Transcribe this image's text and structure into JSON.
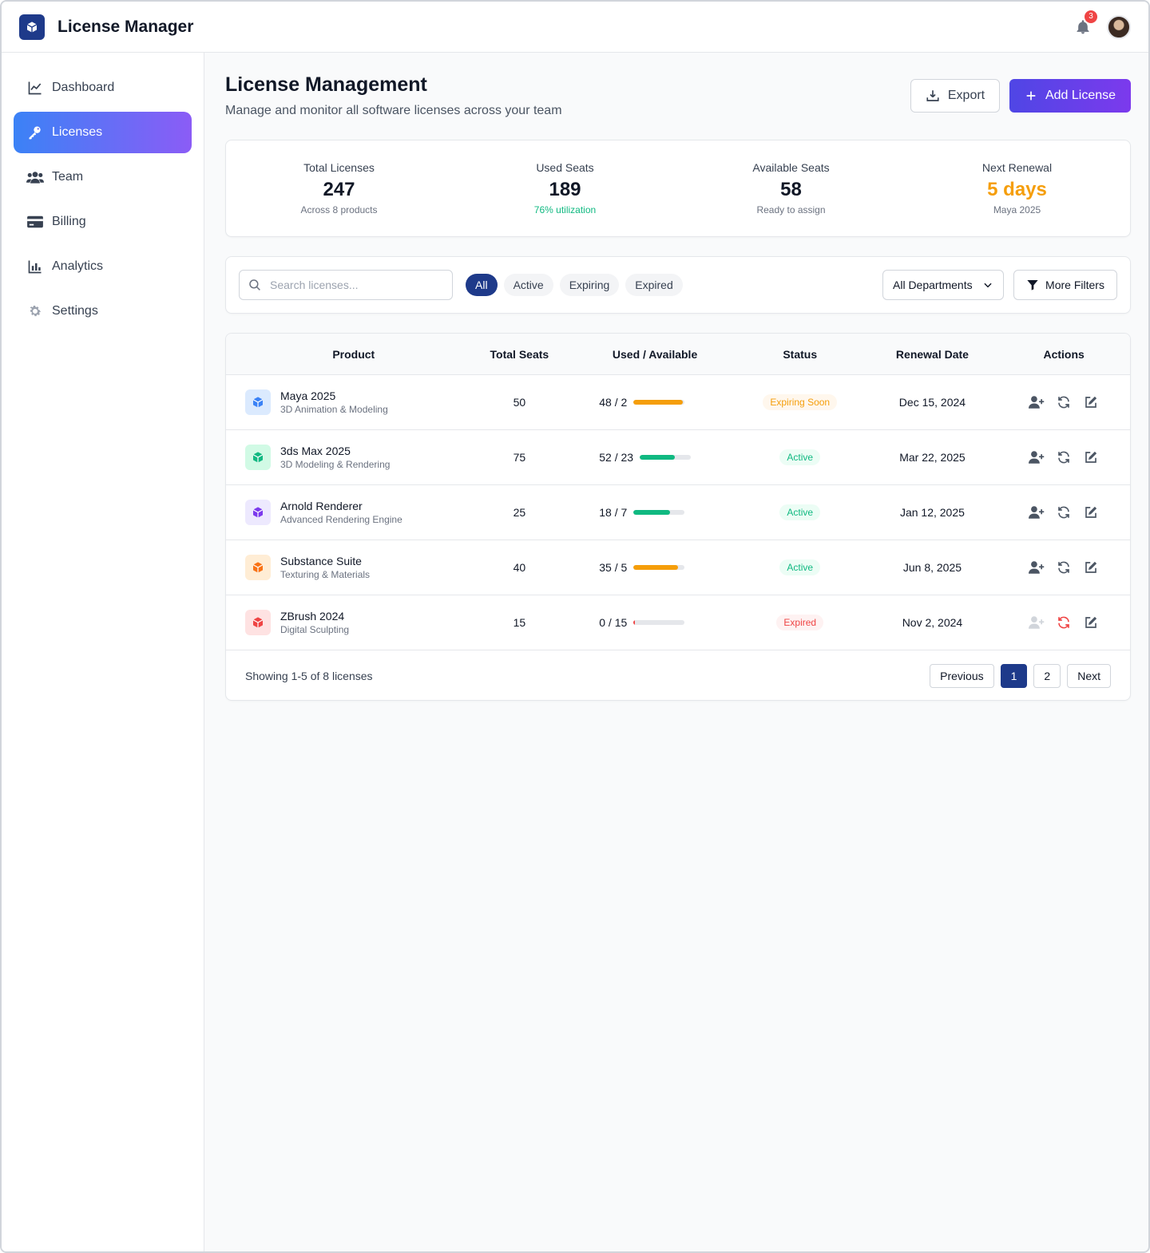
{
  "app": {
    "title": "License Manager",
    "notification_count": "3"
  },
  "sidebar": {
    "items": [
      {
        "label": "Dashboard",
        "icon": "chart-line-icon",
        "active": false
      },
      {
        "label": "Licenses",
        "icon": "key-icon",
        "active": true
      },
      {
        "label": "Team",
        "icon": "users-icon",
        "active": false
      },
      {
        "label": "Billing",
        "icon": "credit-card-icon",
        "active": false
      },
      {
        "label": "Analytics",
        "icon": "bar-chart-icon",
        "active": false
      },
      {
        "label": "Settings",
        "icon": "gear-icon",
        "active": false
      }
    ]
  },
  "page": {
    "title": "License Management",
    "subtitle": "Manage and monitor all software licenses across your team",
    "export_label": "Export",
    "add_label": "Add License"
  },
  "stats": [
    {
      "label": "Total Licenses",
      "value": "247",
      "sub": "Across 8 products"
    },
    {
      "label": "Used Seats",
      "value": "189",
      "sub": "76% utilization"
    },
    {
      "label": "Available Seats",
      "value": "58",
      "sub": "Ready to assign"
    },
    {
      "label": "Next Renewal",
      "value": "5 days",
      "sub": "Maya 2025"
    }
  ],
  "filters": {
    "search_placeholder": "Search licenses...",
    "chips": [
      "All",
      "Active",
      "Expiring",
      "Expired"
    ],
    "active_chip": "All",
    "department": "All Departments",
    "more_filters": "More Filters"
  },
  "table": {
    "headers": {
      "product": "Product",
      "total": "Total Seats",
      "used": "Used / Available",
      "status": "Status",
      "renewal": "Renewal Date",
      "actions": "Actions"
    },
    "rows": [
      {
        "name": "Maya 2025",
        "desc": "3D Animation & Modeling",
        "total": "50",
        "used": "48 / 2",
        "usage": 0.96,
        "bar_color": "#f59e0b",
        "status": "Expiring Soon",
        "status_bg": "#fff7ed",
        "status_fg": "#f59e0b",
        "renewal": "Dec 15, 2024",
        "icon_bg": "#dbeafe",
        "icon_fg": "#3b82f6",
        "assign_enabled": true,
        "renew_alert": false
      },
      {
        "name": "3ds Max 2025",
        "desc": "3D Modeling & Rendering",
        "total": "75",
        "used": "52 / 23",
        "usage": 0.69,
        "bar_color": "#10b981",
        "status": "Active",
        "status_bg": "#ecfdf5",
        "status_fg": "#10b981",
        "renewal": "Mar 22, 2025",
        "icon_bg": "#d1fae5",
        "icon_fg": "#10b981",
        "assign_enabled": true,
        "renew_alert": false
      },
      {
        "name": "Arnold Renderer",
        "desc": "Advanced Rendering Engine",
        "total": "25",
        "used": "18 / 7",
        "usage": 0.72,
        "bar_color": "#10b981",
        "status": "Active",
        "status_bg": "#ecfdf5",
        "status_fg": "#10b981",
        "renewal": "Jan 12, 2025",
        "icon_bg": "#ede9fe",
        "icon_fg": "#7c3aed",
        "assign_enabled": true,
        "renew_alert": false
      },
      {
        "name": "Substance Suite",
        "desc": "Texturing & Materials",
        "total": "40",
        "used": "35 / 5",
        "usage": 0.875,
        "bar_color": "#f59e0b",
        "status": "Active",
        "status_bg": "#ecfdf5",
        "status_fg": "#10b981",
        "renewal": "Jun 8, 2025",
        "icon_bg": "#ffedd5",
        "icon_fg": "#f97316",
        "assign_enabled": true,
        "renew_alert": false
      },
      {
        "name": "ZBrush 2024",
        "desc": "Digital Sculpting",
        "total": "15",
        "used": "0 / 15",
        "usage": 0.0,
        "bar_color": "#ef4444",
        "status": "Expired",
        "status_bg": "#fef2f2",
        "status_fg": "#ef4444",
        "renewal": "Nov 2, 2024",
        "icon_bg": "#fee2e2",
        "icon_fg": "#ef4444",
        "assign_enabled": false,
        "renew_alert": true
      }
    ],
    "footer": "Showing 1-5 of 8 licenses",
    "pager": {
      "previous": "Previous",
      "pages": [
        "1",
        "2"
      ],
      "current": "1",
      "next": "Next"
    }
  },
  "colors": {
    "accent": "#1e3a8a",
    "gradient_start": "#3b82f6",
    "gradient_end": "#8b5cf6",
    "add_gradient_start": "#4f46e5",
    "add_gradient_end": "#7c3aed",
    "utilization_green": "#10b981",
    "renewal_orange": "#f59e0b"
  }
}
